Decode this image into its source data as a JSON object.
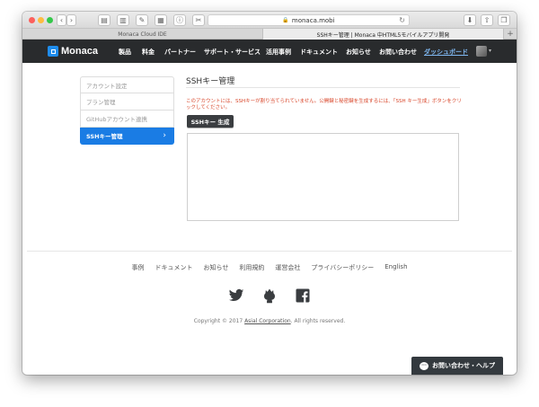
{
  "browser": {
    "address": "monaca.mobi",
    "tabs": [
      {
        "label": "Monaca Cloud IDE",
        "active": false
      },
      {
        "label": "SSHキー管理 | Monaca 中HTML5モバイルアプリ開発",
        "active": true
      }
    ],
    "buttons": [
      "back-icon",
      "forward-icon",
      "sidebar-icon",
      "reader-icon",
      "edit-icon",
      "bookmark-icon",
      "info-icon",
      "tools-icon",
      "download-icon",
      "share-icon",
      "tabs-icon"
    ],
    "traffic_lights": [
      "#fc605c",
      "#fdbc40",
      "#34c84a"
    ]
  },
  "nav": {
    "logo": "Monaca",
    "items": [
      "製品",
      "料金",
      "パートナー",
      "サポート・サービス",
      "活用事例",
      "ドキュメント",
      "お知らせ",
      "お問い合わせ",
      "ダッシュボード"
    ],
    "accent": "#1f8ceb"
  },
  "sidebar": {
    "items": [
      {
        "label": "アカウント設定"
      },
      {
        "label": "プラン管理"
      },
      {
        "label": "GitHubアカウント連携"
      },
      {
        "label": "SSHキー管理"
      }
    ]
  },
  "main": {
    "title": "SSHキー管理",
    "message": "このアカウントには、SSHキーが割り当てられていません。公開鍵と秘密鍵を生成するには、「SSH キー生成」ボタンをクリックしてください。",
    "generate_button": "SSHキー 生成",
    "key_value": ""
  },
  "footer": {
    "links": [
      "事例",
      "ドキュメント",
      "お知らせ",
      "利用規約",
      "運営会社",
      "プライバシーポリシー",
      "English"
    ],
    "social": [
      "twitter-icon",
      "github-icon",
      "facebook-icon"
    ],
    "copyright_prefix": "Copyright © 2017",
    "company": "Asial Corporation",
    "copyright_suffix": ". All rights reserved."
  },
  "help": {
    "label": "お問い合わせ・ヘルプ"
  }
}
